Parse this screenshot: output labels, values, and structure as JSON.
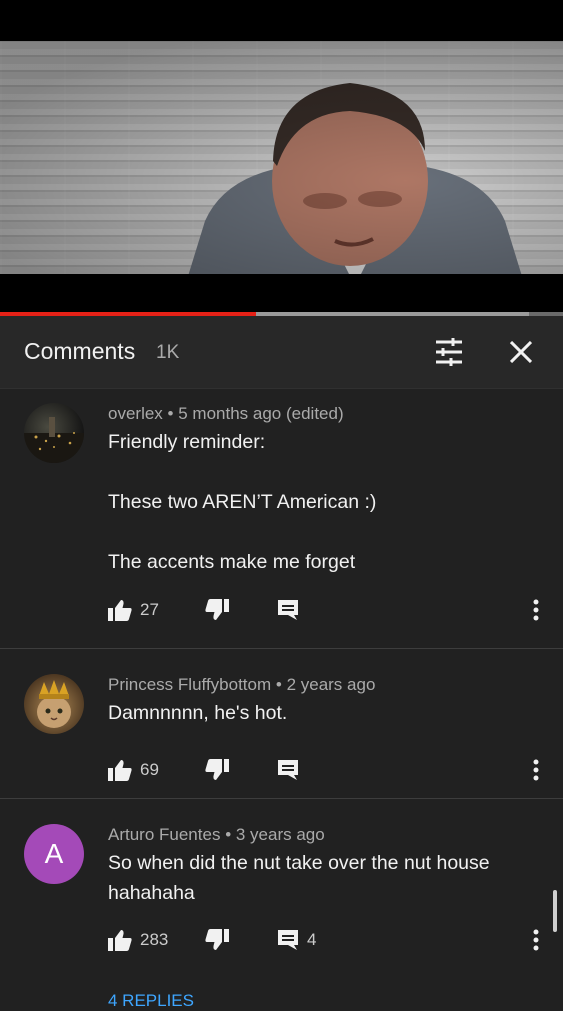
{
  "player": {
    "progress_fraction": 0.455,
    "buffer_fraction": 0.94
  },
  "panel": {
    "title": "Comments",
    "count": "1K",
    "sort_icon": "sort-filter-icon",
    "close_icon": "close-icon"
  },
  "comments": [
    {
      "author": "overlex",
      "sep": "•",
      "time": "5 months ago (edited)",
      "lines": [
        "Friendly reminder:",
        "",
        "These two AREN’T American :)",
        "",
        "The accents make me forget"
      ],
      "likes": "27",
      "replies_count": ""
    },
    {
      "author": "Princess Fluffybottom",
      "sep": "•",
      "time": "2 years ago",
      "lines": [
        "Damnnnnn, he's hot."
      ],
      "likes": "69",
      "replies_count": ""
    },
    {
      "author": "Arturo Fuentes",
      "sep": "•",
      "time": "3 years ago",
      "avatar_letter": "A",
      "avatar_color": "#a44ab8",
      "lines": [
        "So when did the nut take over the nut house",
        "hahahaha"
      ],
      "likes": "283",
      "replies_count": "4",
      "replies_link": "4 REPLIES"
    }
  ],
  "colors": {
    "accent_red": "#e62117",
    "link_blue": "#3ea6ff",
    "background": "#212121"
  }
}
